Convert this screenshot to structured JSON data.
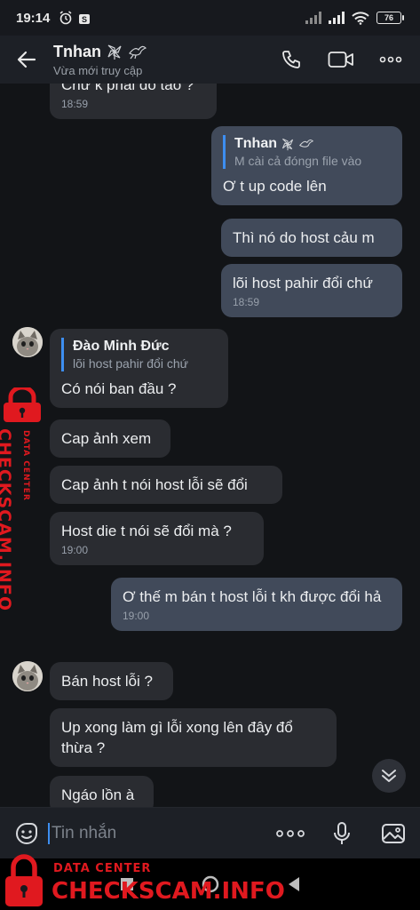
{
  "status_bar": {
    "time": "19:14",
    "battery": "76"
  },
  "header": {
    "contact_name": "Tnhan",
    "presence": "Vừa mới truy cập"
  },
  "messages": [
    {
      "text": "Chứ k phải do tao ?",
      "time": "18:59"
    },
    {
      "quote_name": "Tnhan",
      "quote_text": "M cài cả đóngn file vào",
      "text": "Ơ t up code lên"
    },
    {
      "text": "Thì nó do host cảu m"
    },
    {
      "text": "lõi host pahir đổi chứ",
      "time": "18:59"
    },
    {
      "quote_name": "Đào Minh Đức",
      "quote_text": "lõi host pahir đổi chứ",
      "text": "Có nói ban đầu ?"
    },
    {
      "text": "Cap ảnh xem"
    },
    {
      "text": "Cap ảnh t nói host lỗi sẽ đổi"
    },
    {
      "text": "Host die t nói sẽ đổi mà ?",
      "time": "19:00"
    },
    {
      "text": "Ơ thế m bán t host lỗi t kh được đổi hả",
      "time": "19:00"
    },
    {
      "text": "Bán host lỗi ?"
    },
    {
      "text": "Up xong làm gì lỗi xong lên đây đổ thừa ?"
    },
    {
      "text": "Ngáo lồn à"
    }
  ],
  "input": {
    "placeholder": "Tin nhắn"
  },
  "watermark": {
    "top": "DATA CENTER",
    "brand": "CHECKSCAM.INFO"
  },
  "colors": {
    "accent": "#3d8ef0",
    "incoming_bubble": "#2a2c31",
    "outgoing_bubble": "#414a5a",
    "watermark": "#e0191f"
  }
}
